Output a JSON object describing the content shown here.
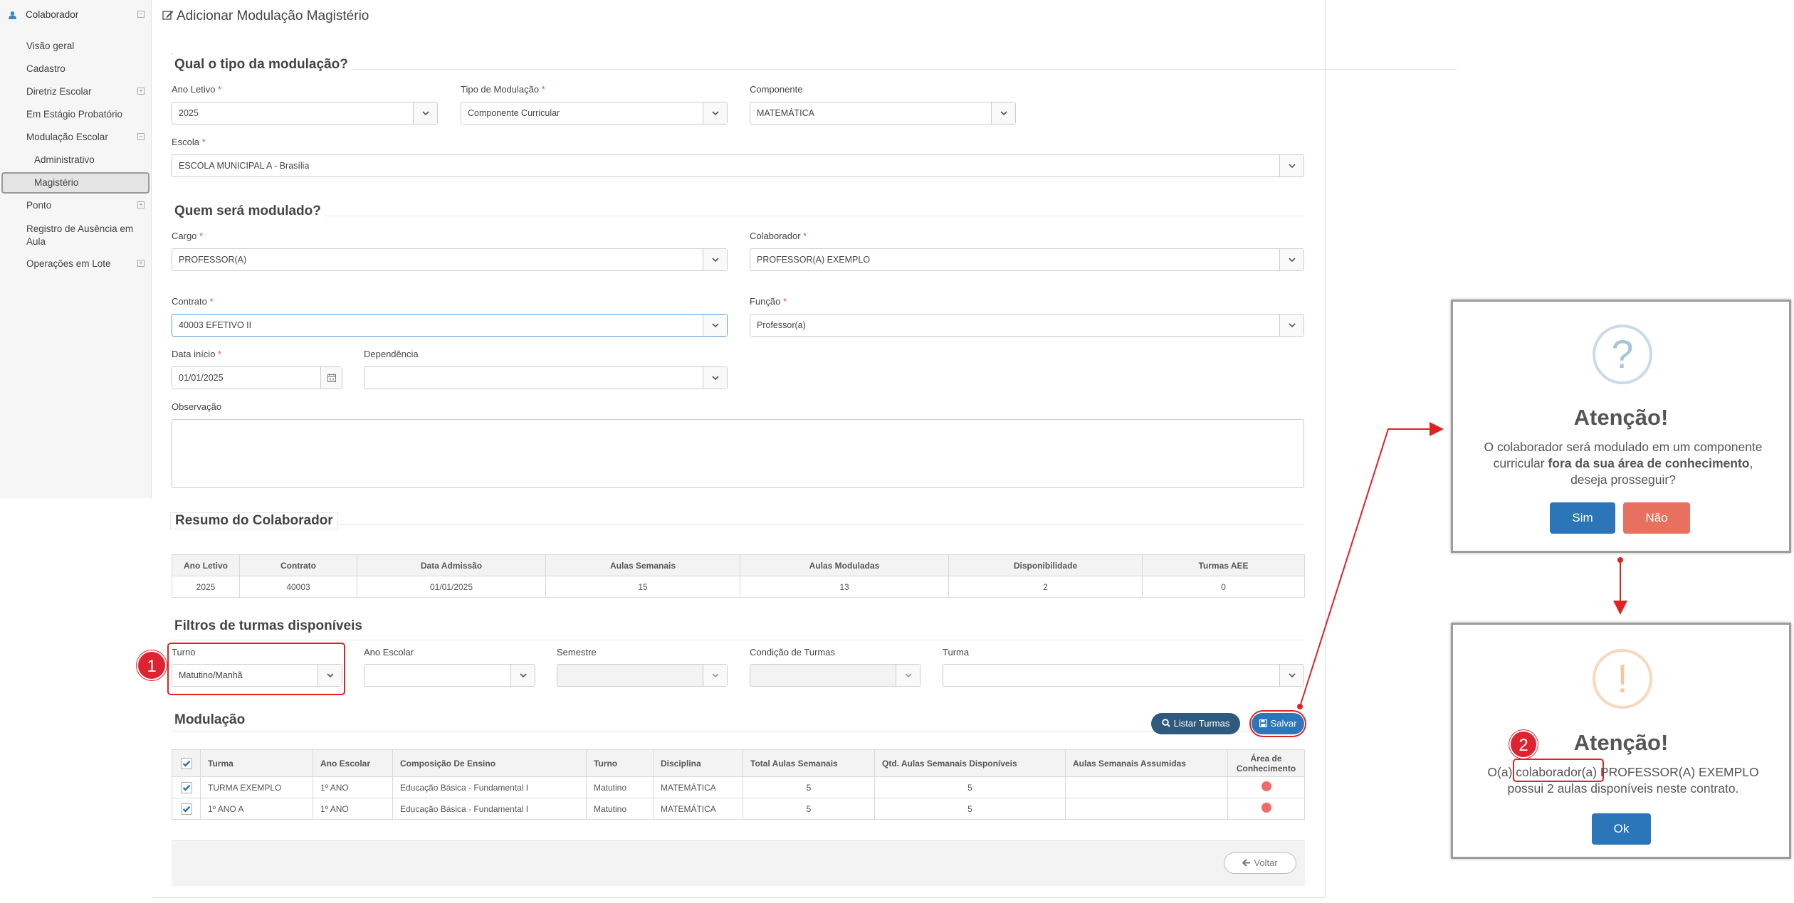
{
  "sidebar": {
    "top": "Colaborador",
    "items": [
      {
        "label": "Visão geral"
      },
      {
        "label": "Cadastro"
      },
      {
        "label": "Diretriz Escolar"
      },
      {
        "label": "Em Estágio Probatório"
      },
      {
        "label": "Modulação Escolar"
      },
      {
        "label": "Administrativo"
      },
      {
        "label": "Magistério"
      },
      {
        "label": "Ponto"
      },
      {
        "label": "Registro de Ausência em Aula"
      },
      {
        "label": "Operações em Lote"
      }
    ],
    "collapse_sign": "−",
    "expand_sign": "+"
  },
  "page": {
    "title": "Adicionar Modulação Magistério"
  },
  "section1": {
    "title": "Qual o tipo da modulação?",
    "ano_letivo": {
      "label": "Ano Letivo",
      "value": "2025"
    },
    "tipo": {
      "label": "Tipo de Modulação",
      "value": "Componente Curricular"
    },
    "componente": {
      "label": "Componente",
      "value": "MATEMÁTICA"
    },
    "escola": {
      "label": "Escola",
      "value": "ESCOLA MUNICIPAL A - Brasília"
    }
  },
  "section2": {
    "title": "Quem será modulado?",
    "cargo": {
      "label": "Cargo",
      "value": "PROFESSOR(A)"
    },
    "colaborador": {
      "label": "Colaborador",
      "value": "PROFESSOR(A) EXEMPLO"
    },
    "contrato": {
      "label": "Contrato",
      "value": "40003 EFETIVO II"
    },
    "funcao": {
      "label": "Função",
      "value": "Professor(a)"
    },
    "data_inicio": {
      "label": "Data início",
      "value": "01/01/2025"
    },
    "dependencia": {
      "label": "Dependência",
      "value": ""
    },
    "observacao": {
      "label": "Observação",
      "value": ""
    }
  },
  "required_mark": "*",
  "resumo": {
    "title": "Resumo do Colaborador",
    "headers": [
      "Ano Letivo",
      "Contrato",
      "Data Admissão",
      "Aulas Semanais",
      "Aulas Moduladas",
      "Disponibilidade",
      "Turmas AEE"
    ],
    "row": [
      "2025",
      "40003",
      "01/01/2025",
      "15",
      "13",
      "2",
      "0"
    ]
  },
  "filtros": {
    "title": "Filtros de turmas disponíveis",
    "turno": {
      "label": "Turno",
      "value": "Matutino/Manhã"
    },
    "ano_escolar": {
      "label": "Ano Escolar",
      "value": ""
    },
    "semestre": {
      "label": "Semestre",
      "value": ""
    },
    "condicao": {
      "label": "Condição de Turmas",
      "value": ""
    },
    "turma": {
      "label": "Turma",
      "value": ""
    }
  },
  "modulacao": {
    "title": "Modulação",
    "listar_btn": "Listar Turmas",
    "salvar_btn": "Salvar",
    "headers": [
      "Turma",
      "Ano Escolar",
      "Composição De Ensino",
      "Turno",
      "Disciplina",
      "Total Aulas Semanais",
      "Qtd. Aulas Semanais Disponíveis",
      "Aulas Semanais Assumidas",
      "Área de Conhecimento"
    ],
    "rows": [
      {
        "turma": "TURMA EXEMPLO",
        "ano": "1º ANO",
        "comp": "Educação Básica - Fundamental I",
        "turno": "Matutino",
        "disc": "MATEMÁTICA",
        "total": "5",
        "disp": "5",
        "assum": ""
      },
      {
        "turma": "1º ANO A",
        "ano": "1º ANO",
        "comp": "Educação Básica - Fundamental I",
        "turno": "Matutino",
        "disc": "MATEMÁTICA",
        "total": "5",
        "disp": "5",
        "assum": ""
      }
    ],
    "voltar_btn": "Voltar"
  },
  "modal1": {
    "icon": "?",
    "title": "Atenção!",
    "text_pre": "O colaborador será modulado em um componente curricular ",
    "text_bold": "fora da sua área de conhecimento",
    "text_post": ", deseja prosseguir?",
    "yes": "Sim",
    "no": "Não"
  },
  "modal2": {
    "icon": "!",
    "title": "Atenção!",
    "text_line1": "O(a) colaborador(a) PROFESSOR(A) EXEMPLO",
    "text_line2": "possui 2 aulas disponíveis neste contrato.",
    "ok": "Ok"
  },
  "badges": [
    "1",
    "2"
  ],
  "colors": {
    "primary": "#2a76b8",
    "dark_button": "#2f5a7e",
    "danger": "#e8705f",
    "annotation": "#e02222",
    "question": "#a9c4d6",
    "warning": "#f5c6a2"
  }
}
